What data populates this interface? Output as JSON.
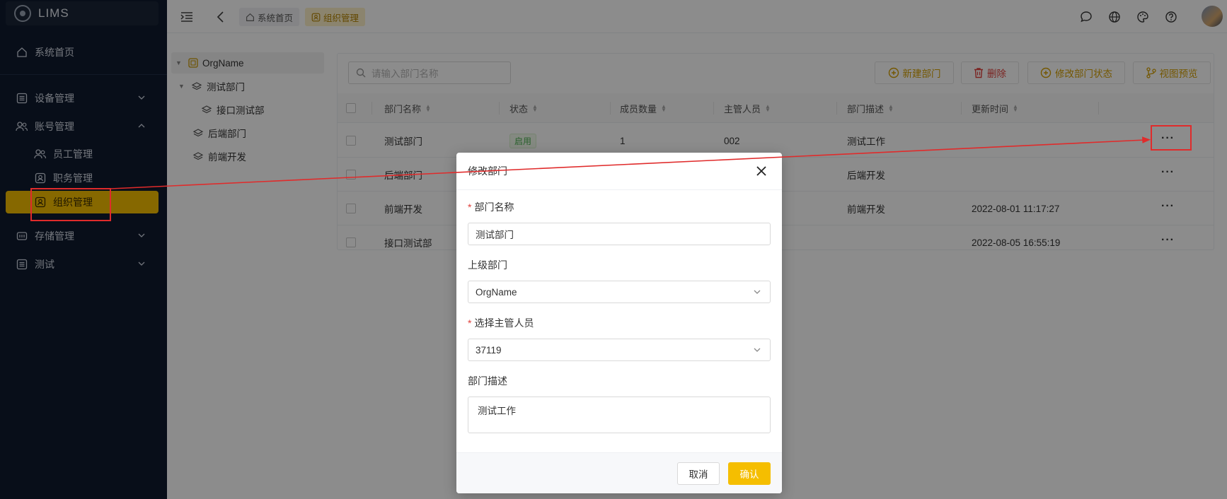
{
  "app": {
    "title": "LIMS"
  },
  "sidebar": {
    "items": [
      {
        "label": "系统首页",
        "icon": "home-icon"
      },
      {
        "label": "设备管理",
        "icon": "grid-icon"
      },
      {
        "label": "账号管理",
        "icon": "users-icon"
      },
      {
        "label": "员工管理",
        "icon": "users-icon"
      },
      {
        "label": "职务管理",
        "icon": "badge-icon"
      },
      {
        "label": "组织管理",
        "icon": "badge-icon"
      },
      {
        "label": "存储管理",
        "icon": "storage-icon"
      },
      {
        "label": "测试",
        "icon": "grid-icon"
      }
    ],
    "active": "组织管理",
    "active_color": "#f5be00"
  },
  "topbar": {
    "breadcrumbs": [
      "系统首页",
      "组织管理"
    ]
  },
  "tree": {
    "root": "OrgName",
    "nodes": [
      "测试部门",
      "接口测试部",
      "后端部门",
      "前端开发"
    ]
  },
  "toolbar": {
    "search_placeholder": "请输入部门名称",
    "new_label": "新建部门",
    "delete_label": "删除",
    "status_label": "修改部门状态",
    "preview_label": "视图预览"
  },
  "table": {
    "columns": [
      "部门名称",
      "状态",
      "成员数量",
      "主管人员",
      "部门描述",
      "更新时间"
    ],
    "rows": [
      {
        "name": "测试部门",
        "status": "启用",
        "members": "1",
        "manager": "002",
        "desc": "测试工作",
        "updated": ""
      },
      {
        "name": "后端部门",
        "status": "",
        "members": "",
        "manager": "",
        "desc": "后端开发",
        "updated": ""
      },
      {
        "name": "前端开发",
        "status": "",
        "members": "",
        "manager": "",
        "desc": "前端开发",
        "updated": "2022-08-01 11:17:27"
      },
      {
        "name": "接口测试部",
        "status": "",
        "members": "",
        "manager": "",
        "desc": "",
        "updated": "2022-08-05 16:55:19"
      }
    ],
    "row_action": "···"
  },
  "modal": {
    "title": "修改部门",
    "name_label": "部门名称",
    "name_value": "测试部门",
    "parent_label": "上级部门",
    "parent_value": "OrgName",
    "manager_label": "选择主管人员",
    "manager_value": "37119",
    "desc_label": "部门描述",
    "desc_value": "测试工作",
    "cancel_label": "取消",
    "ok_label": "确认"
  },
  "colors": {
    "accent": "#f5be00",
    "danger": "#e0413c",
    "annotation": "#e02b2b",
    "sidebar_bg": "#0f1a2e"
  }
}
